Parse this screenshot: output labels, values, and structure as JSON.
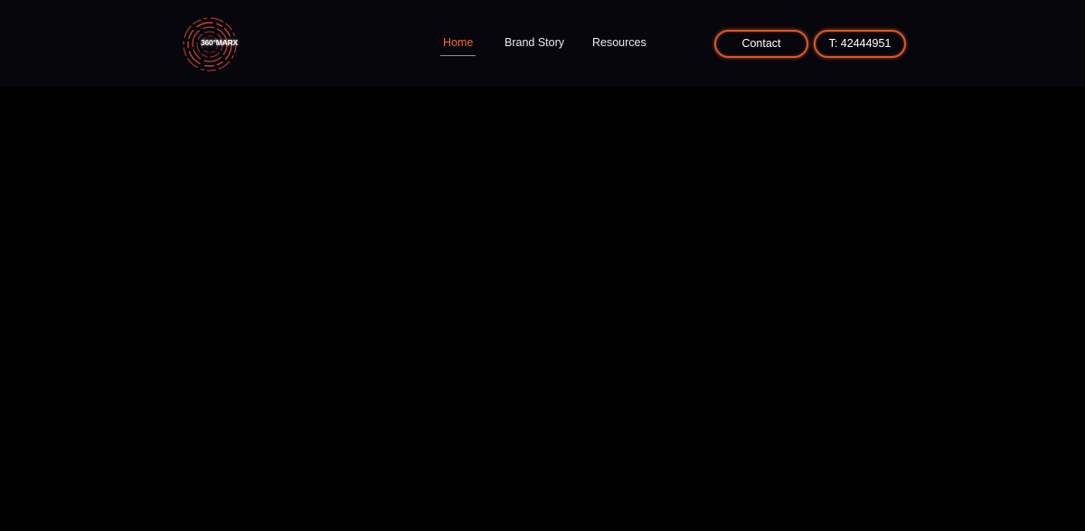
{
  "brand": {
    "logo_text": "360°MARX",
    "accent_color": "#ef6a3a",
    "ring_color": "#c8443a",
    "icon": "concentric-rings-logo"
  },
  "nav": {
    "items": [
      {
        "label": "Home",
        "active": true
      },
      {
        "label": "Brand Story",
        "active": false
      },
      {
        "label": "Resources",
        "active": false
      }
    ]
  },
  "actions": {
    "contact_label": "Contact",
    "phone_label": "T: 42444951",
    "button_border_color": "#d9582c"
  },
  "colors": {
    "header_bg": "#06060c",
    "page_bg": "#000000",
    "nav_text": "#e9e9ee"
  }
}
